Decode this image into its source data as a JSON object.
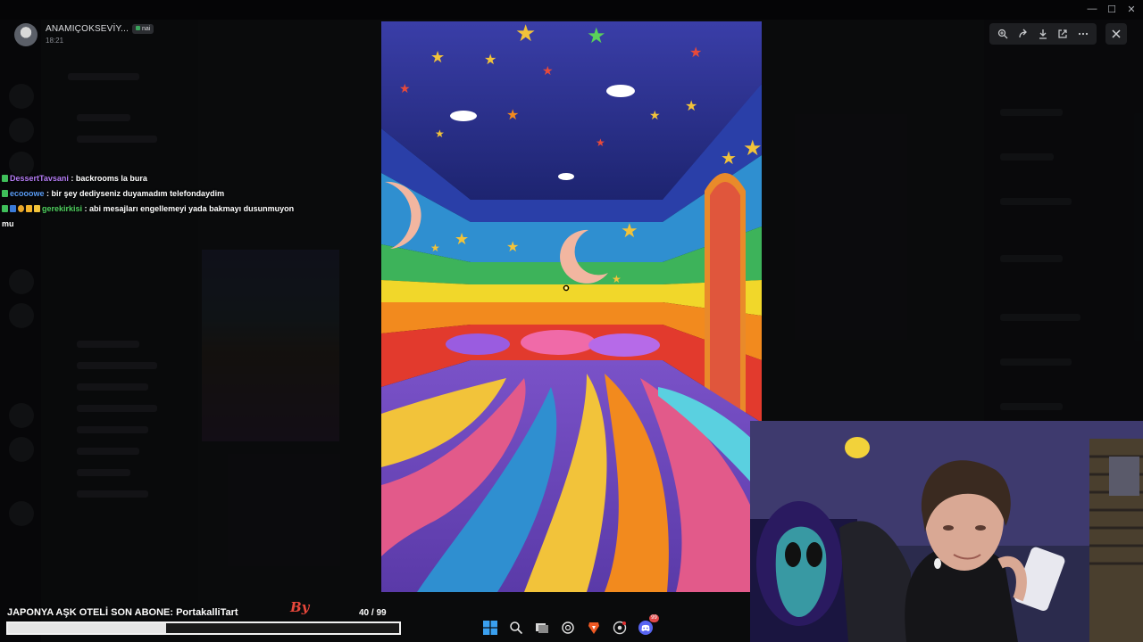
{
  "window_controls": {
    "minimize": "—",
    "maximize": "☐",
    "close": "✕"
  },
  "viewer": {
    "author": "ANAMIÇOKSEVİY...",
    "time": "18:21",
    "badge": "nai"
  },
  "toolbar": {
    "zoom_icon": "zoom-in-icon",
    "forward_icon": "forward-icon",
    "download_icon": "download-icon",
    "open_icon": "open-external-icon",
    "more_icon": "more-icon",
    "close_icon": "close-icon"
  },
  "chat": [
    {
      "user": "DessertTavsani",
      "color": "#b57cf5",
      "message": "backrooms la bura"
    },
    {
      "user": "ecooowe",
      "color": "#5a9cf5",
      "message": "bir şey dediyseniz duyamadım telefondaydim"
    },
    {
      "user": "gerekirkisi",
      "color": "#4fd15f",
      "message": "abi mesajları engellemeyi yada bakmayı dusunmuyon mu"
    }
  ],
  "subgoal": {
    "text": "JAPONYA AŞK OTELİ SON ABONE: PortakalliTart",
    "logo": "By",
    "current": 40,
    "total": 99,
    "count_text": "40  / 99"
  },
  "taskbar": {
    "icons": [
      "windows-start-icon",
      "search-icon",
      "task-view-icon",
      "chatgpt-icon",
      "brave-icon",
      "chrome-icon",
      "discord-icon"
    ],
    "discord_badge": "99"
  }
}
